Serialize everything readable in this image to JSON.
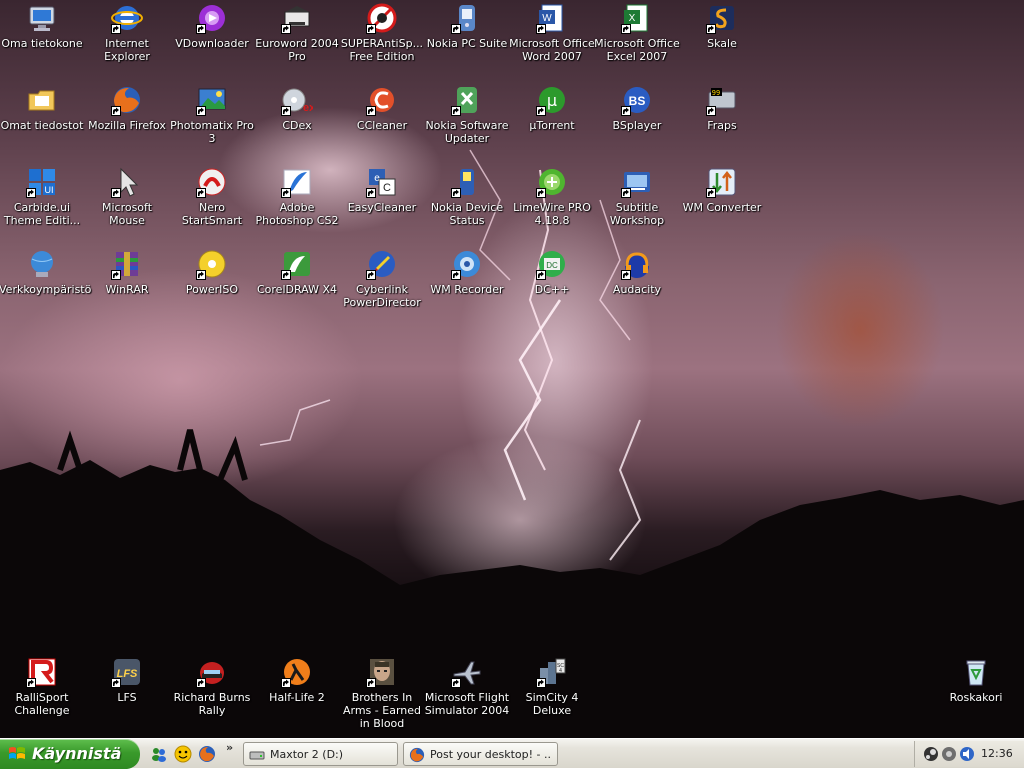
{
  "desktop_icons": [
    {
      "label": "Oma tietokone",
      "icon": "computer-icon"
    },
    {
      "label": "Internet Explorer",
      "icon": "internet-explorer-icon"
    },
    {
      "label": "VDownloader",
      "icon": "vdownloader-icon"
    },
    {
      "label": "Euroword 2004 Pro",
      "icon": "euroword-icon"
    },
    {
      "label": "SUPERAntiSp... Free Edition",
      "icon": "superantispyware-icon"
    },
    {
      "label": "Nokia PC Suite",
      "icon": "nokia-pc-suite-icon"
    },
    {
      "label": "Microsoft Office Word 2007",
      "icon": "word-icon"
    },
    {
      "label": "Microsoft Office Excel 2007",
      "icon": "excel-icon"
    },
    {
      "label": "Skale",
      "icon": "skale-icon"
    },
    {
      "label": "Omat tiedostot",
      "icon": "my-documents-icon"
    },
    {
      "label": "Mozilla Firefox",
      "icon": "firefox-icon"
    },
    {
      "label": "Photomatix Pro 3",
      "icon": "photomatix-icon"
    },
    {
      "label": "CDex",
      "icon": "cdex-icon"
    },
    {
      "label": "CCleaner",
      "icon": "ccleaner-icon"
    },
    {
      "label": "Nokia Software Updater",
      "icon": "nokia-updater-icon"
    },
    {
      "label": "µTorrent",
      "icon": "utorrent-icon"
    },
    {
      "label": "BSplayer",
      "icon": "bsplayer-icon"
    },
    {
      "label": "Fraps",
      "icon": "fraps-icon"
    },
    {
      "label": "Carbide.ui Theme Editi...",
      "icon": "carbide-ui-icon"
    },
    {
      "label": "Microsoft Mouse",
      "icon": "mouse-icon"
    },
    {
      "label": "Nero StartSmart",
      "icon": "nero-icon"
    },
    {
      "label": "Adobe Photoshop CS2",
      "icon": "photoshop-icon"
    },
    {
      "label": "EasyCleaner",
      "icon": "easycleaner-icon"
    },
    {
      "label": "Nokia Device Status",
      "icon": "nokia-device-icon"
    },
    {
      "label": "LimeWire PRO 4.18.8",
      "icon": "limewire-icon"
    },
    {
      "label": "Subtitle Workshop",
      "icon": "subtitle-workshop-icon"
    },
    {
      "label": "WM Converter",
      "icon": "wm-converter-icon"
    },
    {
      "label": "Verkkoympäristö",
      "icon": "network-icon"
    },
    {
      "label": "WinRAR",
      "icon": "winrar-icon"
    },
    {
      "label": "PowerISO",
      "icon": "poweriso-icon"
    },
    {
      "label": "CorelDRAW X4",
      "icon": "coreldraw-icon"
    },
    {
      "label": "Cyberlink PowerDirector",
      "icon": "powerdirector-icon"
    },
    {
      "label": "WM Recorder",
      "icon": "wm-recorder-icon"
    },
    {
      "label": "DC++",
      "icon": "dcpp-icon"
    },
    {
      "label": "Audacity",
      "icon": "audacity-icon"
    },
    {
      "label": "RalliSport Challenge",
      "icon": "rallisport-icon"
    },
    {
      "label": "LFS",
      "icon": "lfs-icon"
    },
    {
      "label": "Richard Burns Rally",
      "icon": "richard-burns-icon"
    },
    {
      "label": "Half-Life 2",
      "icon": "half-life-2-icon"
    },
    {
      "label": "Brothers In Arms - Earned in Blood",
      "icon": "brothers-in-arms-icon"
    },
    {
      "label": "Microsoft Flight Simulator 2004",
      "icon": "flight-simulator-icon"
    },
    {
      "label": "SimCity 4 Deluxe",
      "icon": "simcity-icon"
    },
    {
      "label": "Roskakori",
      "icon": "recycle-bin-icon"
    }
  ],
  "taskbar": {
    "start_label": "Käynnistä",
    "quick_launch": [
      "msn-messenger-icon",
      "yahoo-messenger-icon",
      "firefox-icon"
    ],
    "quick_launch_more": "»",
    "tasks": [
      {
        "label": "Maxtor 2 (D:)",
        "icon": "drive-icon"
      },
      {
        "label": "Post your desktop! - ...",
        "icon": "firefox-icon"
      }
    ],
    "tray_icons": [
      "steam-icon",
      "network-tray-icon",
      "volume-icon"
    ],
    "clock": "12:36"
  }
}
